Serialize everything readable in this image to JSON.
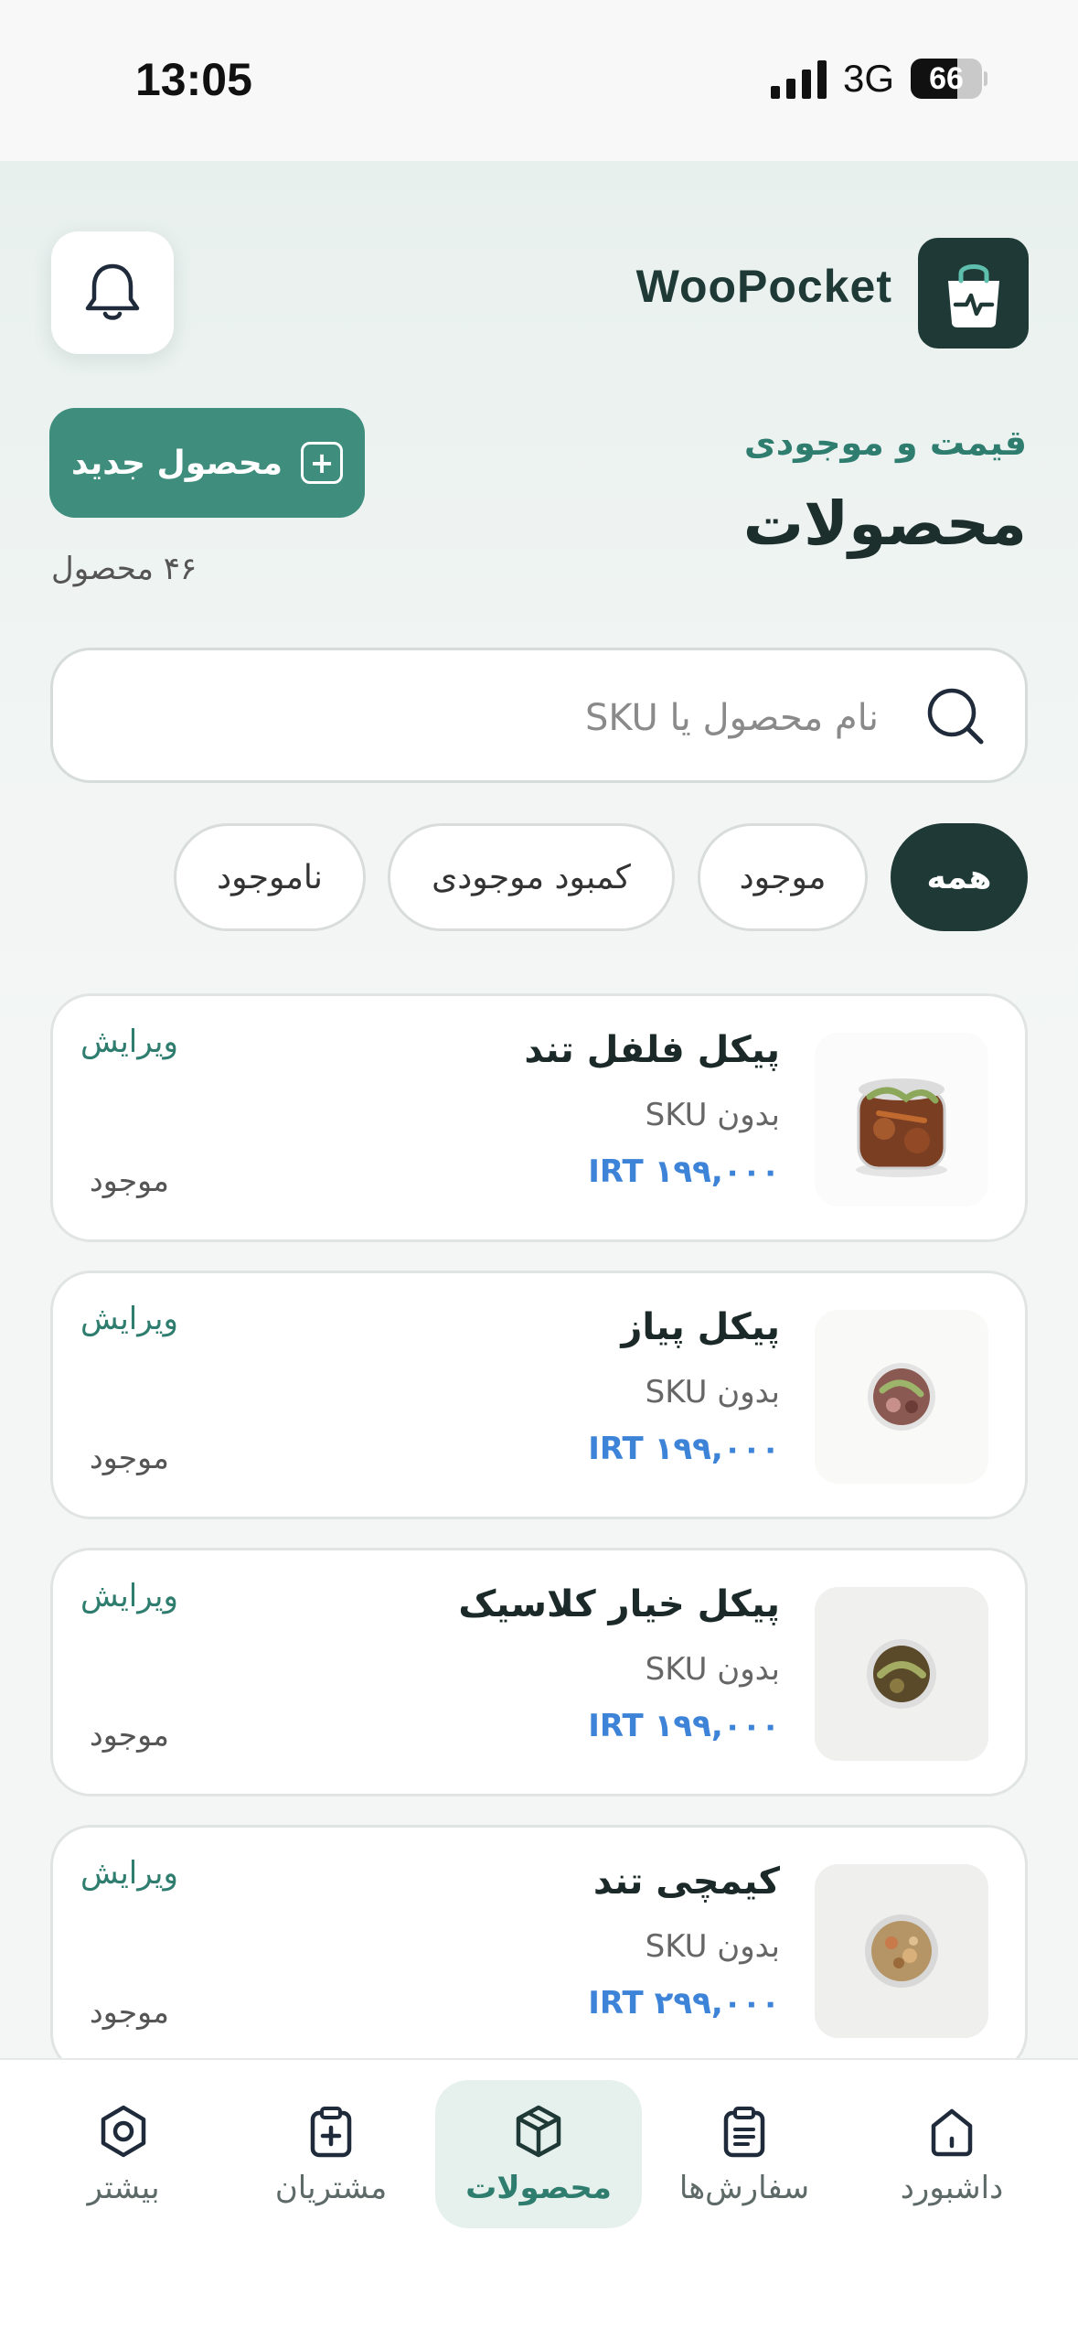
{
  "status_bar": {
    "time": "13:05",
    "network": "3G",
    "battery": "66",
    "battery_level": 0.66
  },
  "header": {
    "brand": "WooPocket",
    "kicker": "قیمت و موجودی",
    "title": "محصولات",
    "new_button": "محصول جدید",
    "count": "۴۶ محصول"
  },
  "search": {
    "placeholder": "نام محصول یا SKU",
    "value": ""
  },
  "filters": [
    {
      "label": "همه",
      "active": true
    },
    {
      "label": "موجود",
      "active": false
    },
    {
      "label": "کمبود موجودی",
      "active": false
    },
    {
      "label": "ناموجود",
      "active": false
    }
  ],
  "products": [
    {
      "name": "پیکل فلفل تند",
      "sku": "بدون SKU",
      "price": "IRT ۱۹۹,۰۰۰",
      "edit": "ویرایش",
      "stock": "موجود"
    },
    {
      "name": "پیکل پیاز",
      "sku": "بدون SKU",
      "price": "IRT ۱۹۹,۰۰۰",
      "edit": "ویرایش",
      "stock": "موجود"
    },
    {
      "name": "پیکل خیار کلاسیک",
      "sku": "بدون SKU",
      "price": "IRT ۱۹۹,۰۰۰",
      "edit": "ویرایش",
      "stock": "موجود"
    },
    {
      "name": "کیمچی تند",
      "sku": "بدون SKU",
      "price": "IRT ۲۹۹,۰۰۰",
      "edit": "ویرایش",
      "stock": "موجود"
    }
  ],
  "tabs": [
    {
      "label": "داشبورد",
      "icon": "home-icon",
      "active": false
    },
    {
      "label": "سفارش‌ها",
      "icon": "clipboard-list-icon",
      "active": false
    },
    {
      "label": "محصولات",
      "icon": "box-icon",
      "active": true
    },
    {
      "label": "مشتریان",
      "icon": "clipboard-plus-icon",
      "active": false
    },
    {
      "label": "بیشتر",
      "icon": "hexagon-settings-icon",
      "active": false
    }
  ],
  "colors": {
    "brand_dark": "#1f3a36",
    "accent": "#3e8d7d",
    "price": "#3d83d8"
  }
}
